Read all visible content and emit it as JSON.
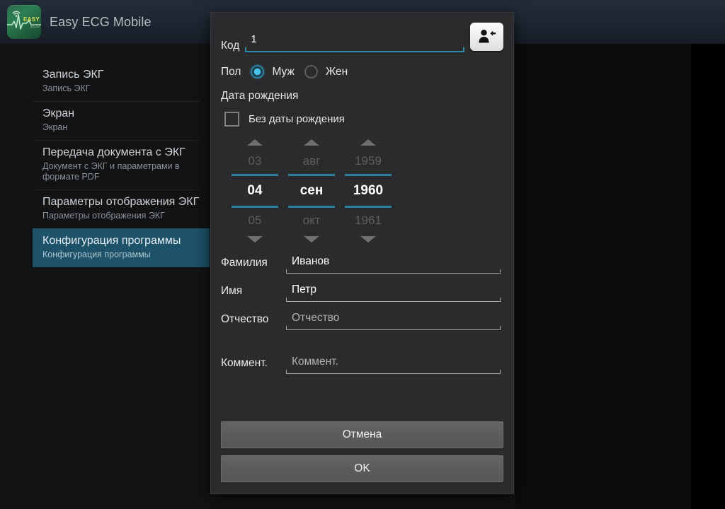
{
  "window": {
    "app_title": "Easy ECG Mobile",
    "app_icon_name": "easy-ecg-logo",
    "icon_text_top": "EASY",
    "icon_text_bottom": "ECG"
  },
  "sidebar": {
    "items": [
      {
        "title": "Запись ЭКГ",
        "subtitle": "Запись ЭКГ",
        "selected": false
      },
      {
        "title": "Экран",
        "subtitle": "Экран",
        "selected": false
      },
      {
        "title": "Передача документа с ЭКГ",
        "subtitle": "Документ с ЭКГ и параметрами в формате PDF",
        "selected": false
      },
      {
        "title": "Параметры отображения ЭКГ",
        "subtitle": "Параметры отображения ЭКГ",
        "selected": false
      },
      {
        "title": "Конфигурация программы",
        "subtitle": "Конфигурация программы",
        "selected": true
      }
    ]
  },
  "dialog": {
    "code": {
      "label": "Код",
      "value": "1",
      "import_button_name": "import-patient-button"
    },
    "gender": {
      "label": "Пол",
      "options": [
        {
          "label": "Муж",
          "selected": true
        },
        {
          "label": "Жен",
          "selected": false
        }
      ]
    },
    "birth": {
      "label": "Дата рождения",
      "no_date_checkbox": {
        "label": "Без даты рождения",
        "checked": false
      },
      "day": {
        "prev": "03",
        "current": "04",
        "next": "05"
      },
      "month": {
        "prev": "авг",
        "current": "сен",
        "next": "окт"
      },
      "year": {
        "prev": "1959",
        "current": "1960",
        "next": "1961"
      }
    },
    "fields": [
      {
        "label": "Фамилия",
        "value": "Иванов",
        "placeholder": "Фамилия",
        "is_placeholder": false
      },
      {
        "label": "Имя",
        "value": "Петр",
        "placeholder": "Имя",
        "is_placeholder": false
      },
      {
        "label": "Отчество",
        "value": "Отчество",
        "placeholder": "Отчество",
        "is_placeholder": true
      }
    ],
    "comment": {
      "label": "Коммент.",
      "value": "Коммент.",
      "placeholder": "Коммент.",
      "is_placeholder": true
    },
    "buttons": {
      "cancel": "Отмена",
      "ok": "OK"
    }
  },
  "colors": {
    "accent_teal": "#268ca5",
    "radio_on": "#33b5e5",
    "selected_row": "#1d5269",
    "dialog_bg": "#2b2b2d",
    "titlebar": "#1d2631"
  }
}
